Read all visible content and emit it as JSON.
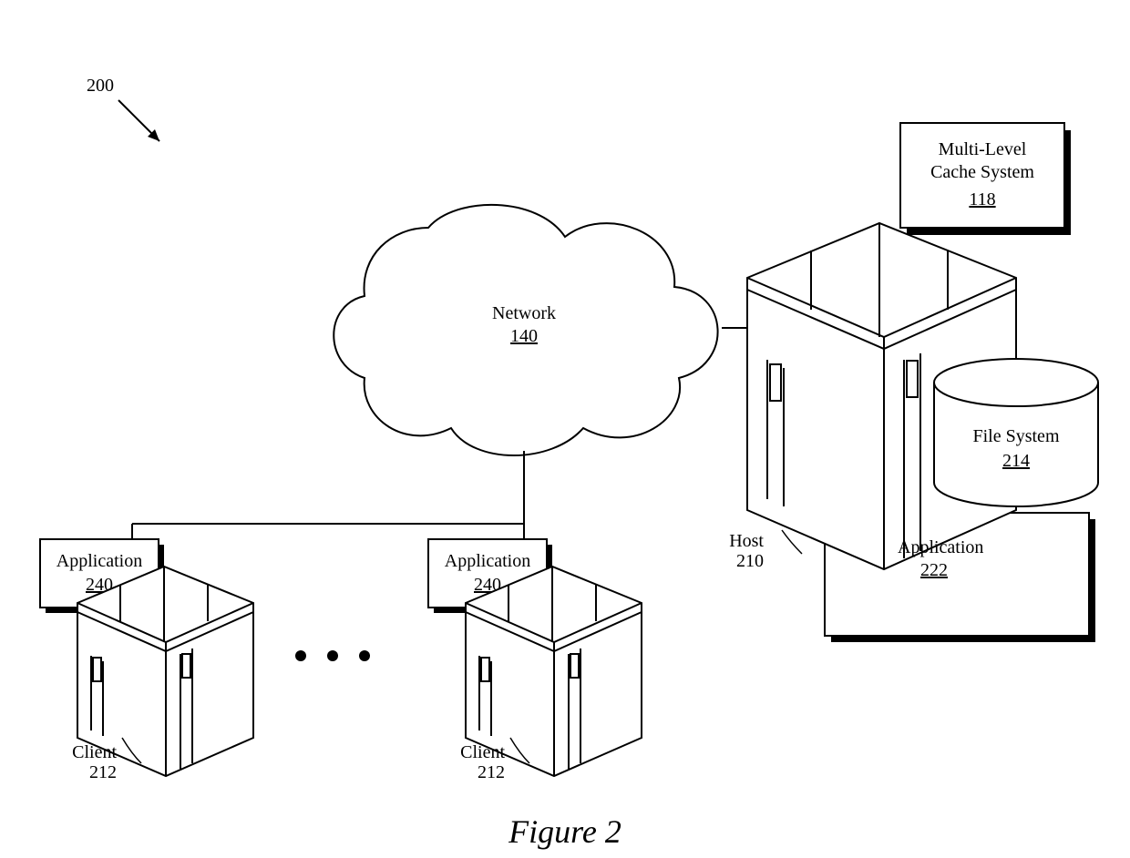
{
  "figure": {
    "ref_num": "200",
    "caption": "Figure 2"
  },
  "network": {
    "label": "Network",
    "num": "140"
  },
  "cache": {
    "line1": "Multi-Level",
    "line2": "Cache System",
    "num": "118"
  },
  "filesystem": {
    "label": "File System",
    "num": "214"
  },
  "host": {
    "label": "Host",
    "num": "210"
  },
  "host_app": {
    "label": "Application",
    "num": "222"
  },
  "client1": {
    "label": "Client",
    "num": "212",
    "app_label": "Application",
    "app_num": "240"
  },
  "client2": {
    "label": "Client",
    "num": "212",
    "app_label": "Application",
    "app_num": "240"
  }
}
